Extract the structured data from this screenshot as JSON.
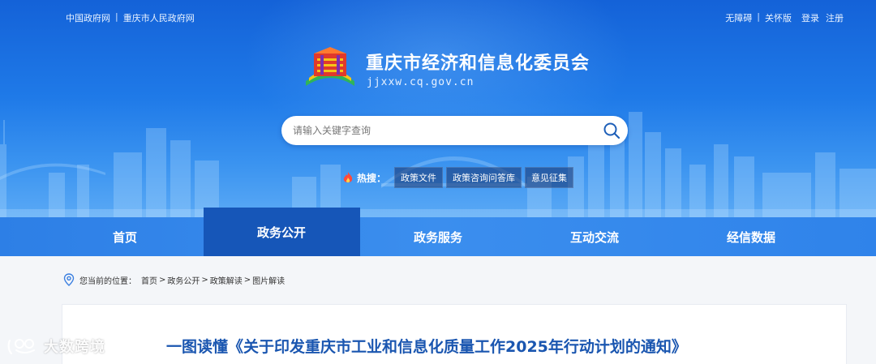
{
  "top_links_left": {
    "gov": "中国政府网",
    "sep": "|",
    "city": "重庆市人民政府网"
  },
  "top_links_right": {
    "accessible": "无障碍",
    "sep": "|",
    "care": "关怀版",
    "login": "登录",
    "register": "注册"
  },
  "site": {
    "title": "重庆市经济和信息化委员会",
    "url": "jjxxw.cq.gov.cn"
  },
  "search": {
    "placeholder": "请输入关键字查询",
    "icon": "search-icon"
  },
  "hot": {
    "label": "热搜：",
    "tags": [
      "政策文件",
      "政策咨询问答库",
      "意见征集"
    ]
  },
  "nav": {
    "items": [
      "首页",
      "政务公开",
      "政务服务",
      "互动交流",
      "经信数据"
    ],
    "active": "政务公开"
  },
  "breadcrumb": {
    "prefix": "您当前的位置：",
    "items": [
      "首页",
      "政务公开",
      "政策解读",
      "图片解读"
    ],
    "separator": ">"
  },
  "article": {
    "title": "一图读懂《关于印发重庆市工业和信息化质量工作2025年行动计划的通知》"
  },
  "watermark": {
    "text": "大数跨境"
  },
  "colors": {
    "banner_top": "#1462d8",
    "nav": "#3b8eee",
    "nav_active": "#1656b8",
    "title_blue": "#1a56b0"
  }
}
